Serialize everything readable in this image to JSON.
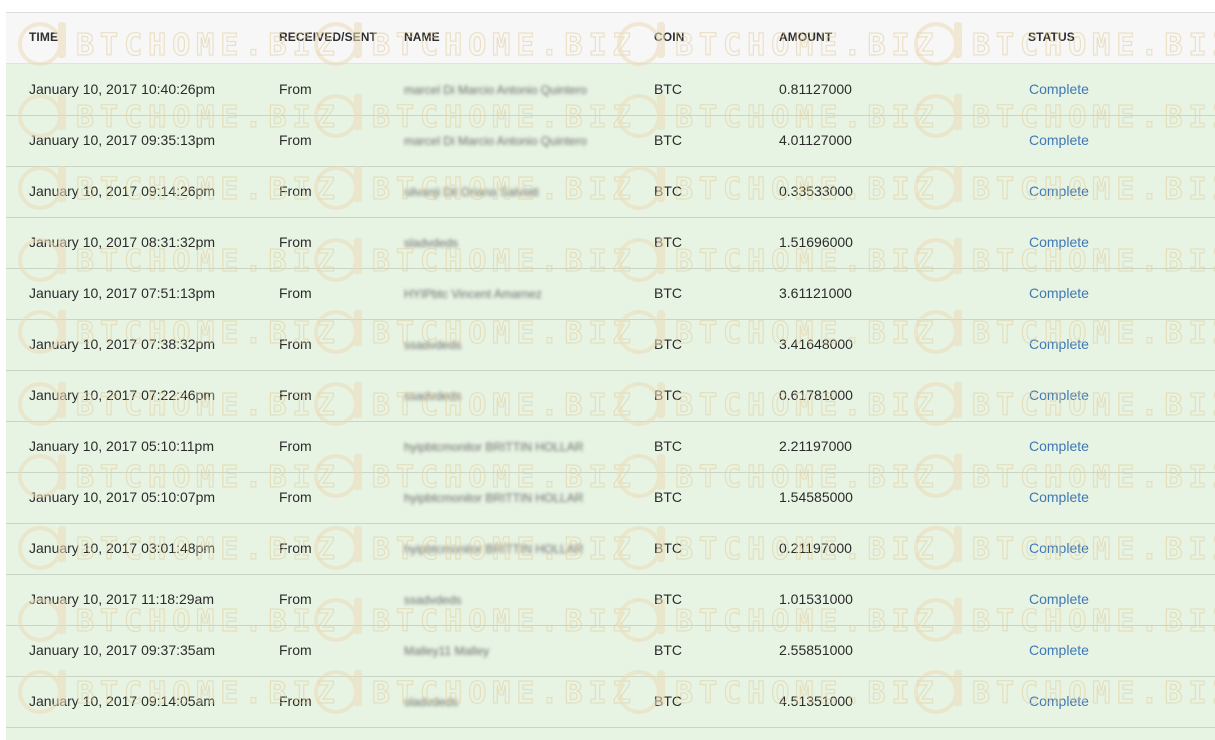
{
  "table": {
    "headers": {
      "time": "TIME",
      "received_sent": "RECEIVED/SENT",
      "name": "NAME",
      "coin": "COIN",
      "amount": "AMOUNT",
      "status": "STATUS"
    },
    "rows": [
      {
        "time": "January 10, 2017 10:40:26pm",
        "direction": "From",
        "name": "marcel Di Marcio Antonio Quintero",
        "coin": "BTC",
        "amount": "0.81127000",
        "status": "Complete"
      },
      {
        "time": "January 10, 2017 09:35:13pm",
        "direction": "From",
        "name": "marcel Di Marcio Antonio Quintero",
        "coin": "BTC",
        "amount": "4.01127000",
        "status": "Complete"
      },
      {
        "time": "January 10, 2017 09:14:26pm",
        "direction": "From",
        "name": "silvanji Dil Oriana Salviati",
        "coin": "BTC",
        "amount": "0.33533000",
        "status": "Complete"
      },
      {
        "time": "January 10, 2017 08:31:32pm",
        "direction": "From",
        "name": "sladvdeds",
        "coin": "BTC",
        "amount": "1.51696000",
        "status": "Complete"
      },
      {
        "time": "January 10, 2017 07:51:13pm",
        "direction": "From",
        "name": "HYIPbtc Vincent Amarnez",
        "coin": "BTC",
        "amount": "3.61121000",
        "status": "Complete"
      },
      {
        "time": "January 10, 2017 07:38:32pm",
        "direction": "From",
        "name": "ssadvdeds",
        "coin": "BTC",
        "amount": "3.41648000",
        "status": "Complete"
      },
      {
        "time": "January 10, 2017 07:22:46pm",
        "direction": "From",
        "name": "ssadvdeds",
        "coin": "BTC",
        "amount": "0.61781000",
        "status": "Complete"
      },
      {
        "time": "January 10, 2017 05:10:11pm",
        "direction": "From",
        "name": "hyipbtcmonitor BRITTIN HOLLAR",
        "coin": "BTC",
        "amount": "2.21197000",
        "status": "Complete"
      },
      {
        "time": "January 10, 2017 05:10:07pm",
        "direction": "From",
        "name": "hyipbtcmonitor BRITTIN HOLLAR",
        "coin": "BTC",
        "amount": "1.54585000",
        "status": "Complete"
      },
      {
        "time": "January 10, 2017 03:01:48pm",
        "direction": "From",
        "name": "hyipbtcmonitor BRITTIN HOLLAR",
        "coin": "BTC",
        "amount": "0.21197000",
        "status": "Complete"
      },
      {
        "time": "January 10, 2017 11:18:29am",
        "direction": "From",
        "name": "ssadvdeds",
        "coin": "BTC",
        "amount": "1.01531000",
        "status": "Complete"
      },
      {
        "time": "January 10, 2017 09:37:35am",
        "direction": "From",
        "name": "Malley11 Malley",
        "coin": "BTC",
        "amount": "2.55851000",
        "status": "Complete"
      },
      {
        "time": "January 10, 2017 09:14:05am",
        "direction": "From",
        "name": "sladvdeds",
        "coin": "BTC",
        "amount": "4.51351000",
        "status": "Complete"
      }
    ]
  },
  "watermark": {
    "text": "BTCHOME.BIZ",
    "icon": "btchome-logo-icon"
  },
  "colors": {
    "row_bg": "#e7f3e3",
    "header_bg": "#f7f7f7",
    "status": "#3f78b5"
  }
}
